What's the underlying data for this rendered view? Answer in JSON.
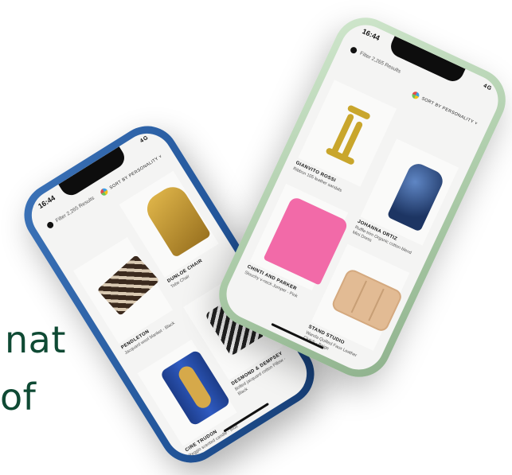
{
  "background": {
    "line1": "nat",
    "line2": "of"
  },
  "green_phone": {
    "status_time": "16:44",
    "status_signal": "4G",
    "filter_label": "Filter",
    "results_count": "2,265 Results",
    "sort_label": "SORT BY PERSONALITY",
    "products": [
      {
        "brand": "GIANVITO ROSSI",
        "desc": "Ribbon 105 leather sandals"
      },
      {
        "brand": "JOHANNA ORTIZ",
        "desc": "Ruffle-trim Organic cotton-blend Mini Dress"
      },
      {
        "brand": "CHINTI AND PARKER",
        "desc": "Slouchy v-neck Jumper - Pink"
      },
      {
        "brand": "STAND STUDIO",
        "desc": "Wanda Quilted Faux Leather Clutch - Beige"
      }
    ]
  },
  "blue_phone": {
    "status_time": "16:44",
    "status_signal": "4G",
    "filter_label": "Filter",
    "results_count": "2,265 Results",
    "sort_label": "SORT BY PERSONALITY",
    "products": [
      {
        "brand": "PENDLETON",
        "desc": "Jacquard wool blanket - Black"
      },
      {
        "brand": "DUNLOE CHAIR",
        "desc": "Tobe Chair"
      },
      {
        "brand": "CIRE TRUDON",
        "desc": "Reggio scented candle - Blue"
      },
      {
        "brand": "DESMOND & DEMPSEY",
        "desc": "Bolted jacquard cotton Pillow - Black"
      }
    ]
  },
  "colors": {
    "headline": "#0f4a34",
    "green_frame": "#a9c9a6",
    "blue_frame": "#22559a"
  }
}
